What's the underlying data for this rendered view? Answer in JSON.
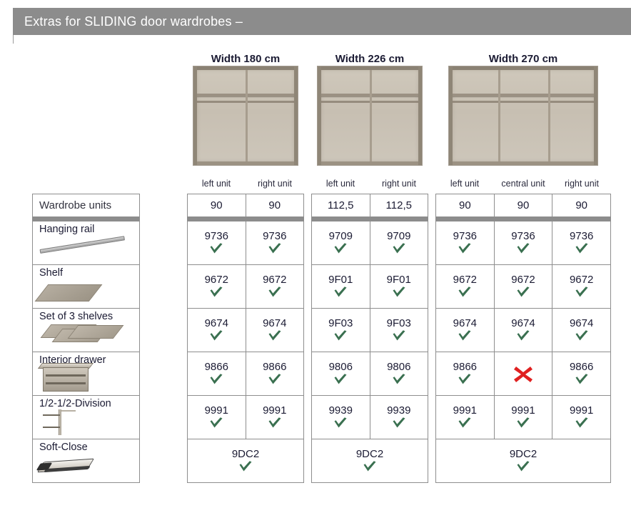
{
  "header": {
    "title": "Extras for SLIDING door wardrobes –"
  },
  "colors": {
    "header_bar": "#8c8c8c",
    "check_green": "#3a7050",
    "cross_red": "#e02020",
    "grid_line": "#8e8e8e",
    "text": "#1b1b33"
  },
  "sidebar": {
    "header_label": "Wardrobe units",
    "items": [
      {
        "label": "Hanging rail",
        "icon": "hanging-rail-icon"
      },
      {
        "label": "Shelf",
        "icon": "shelf-icon"
      },
      {
        "label": "Set of 3 shelves",
        "icon": "set-of-3-shelves-icon"
      },
      {
        "label": "Interior drawer",
        "icon": "interior-drawer-icon"
      },
      {
        "label": "1/2-1/2-Division",
        "icon": "half-half-division-icon"
      },
      {
        "label": "Soft-Close",
        "icon": "soft-close-icon"
      }
    ]
  },
  "groups": [
    {
      "id": "width-180",
      "heading": "Width 180 cm",
      "photo_alt": "wardrobe-180-interior",
      "photo_sections": 2,
      "unit_labels": [
        "left unit",
        "right unit"
      ],
      "unit_widths": [
        "90",
        "90"
      ],
      "rows": [
        {
          "item": "Hanging rail",
          "cells": [
            {
              "code": "9736",
              "mark": "check"
            },
            {
              "code": "9736",
              "mark": "check"
            }
          ]
        },
        {
          "item": "Shelf",
          "cells": [
            {
              "code": "9672",
              "mark": "check"
            },
            {
              "code": "9672",
              "mark": "check"
            }
          ]
        },
        {
          "item": "Set of 3 shelves",
          "cells": [
            {
              "code": "9674",
              "mark": "check"
            },
            {
              "code": "9674",
              "mark": "check"
            }
          ]
        },
        {
          "item": "Interior drawer",
          "cells": [
            {
              "code": "9866",
              "mark": "check"
            },
            {
              "code": "9866",
              "mark": "check"
            }
          ]
        },
        {
          "item": "1/2-1/2-Division",
          "cells": [
            {
              "code": "9991",
              "mark": "check"
            },
            {
              "code": "9991",
              "mark": "check"
            }
          ]
        }
      ],
      "footer_row": {
        "item": "Soft-Close",
        "code": "9DC2",
        "mark": "check"
      }
    },
    {
      "id": "width-226",
      "heading": "Width 226 cm",
      "photo_alt": "wardrobe-226-interior",
      "photo_sections": 2,
      "unit_labels": [
        "left unit",
        "right unit"
      ],
      "unit_widths": [
        "112,5",
        "112,5"
      ],
      "rows": [
        {
          "item": "Hanging rail",
          "cells": [
            {
              "code": "9709",
              "mark": "check"
            },
            {
              "code": "9709",
              "mark": "check"
            }
          ]
        },
        {
          "item": "Shelf",
          "cells": [
            {
              "code": "9F01",
              "mark": "check"
            },
            {
              "code": "9F01",
              "mark": "check"
            }
          ]
        },
        {
          "item": "Set of 3 shelves",
          "cells": [
            {
              "code": "9F03",
              "mark": "check"
            },
            {
              "code": "9F03",
              "mark": "check"
            }
          ]
        },
        {
          "item": "Interior drawer",
          "cells": [
            {
              "code": "9806",
              "mark": "check"
            },
            {
              "code": "9806",
              "mark": "check"
            }
          ]
        },
        {
          "item": "1/2-1/2-Division",
          "cells": [
            {
              "code": "9939",
              "mark": "check"
            },
            {
              "code": "9939",
              "mark": "check"
            }
          ]
        }
      ],
      "footer_row": {
        "item": "Soft-Close",
        "code": "9DC2",
        "mark": "check"
      }
    },
    {
      "id": "width-270",
      "heading": "Width 270 cm",
      "photo_alt": "wardrobe-270-interior",
      "photo_sections": 3,
      "unit_labels": [
        "left unit",
        "central unit",
        "right unit"
      ],
      "unit_widths": [
        "90",
        "90",
        "90"
      ],
      "rows": [
        {
          "item": "Hanging rail",
          "cells": [
            {
              "code": "9736",
              "mark": "check"
            },
            {
              "code": "9736",
              "mark": "check"
            },
            {
              "code": "9736",
              "mark": "check"
            }
          ]
        },
        {
          "item": "Shelf",
          "cells": [
            {
              "code": "9672",
              "mark": "check"
            },
            {
              "code": "9672",
              "mark": "check"
            },
            {
              "code": "9672",
              "mark": "check"
            }
          ]
        },
        {
          "item": "Set of 3 shelves",
          "cells": [
            {
              "code": "9674",
              "mark": "check"
            },
            {
              "code": "9674",
              "mark": "check"
            },
            {
              "code": "9674",
              "mark": "check"
            }
          ]
        },
        {
          "item": "Interior drawer",
          "cells": [
            {
              "code": "9866",
              "mark": "check"
            },
            {
              "code": "",
              "mark": "cross"
            },
            {
              "code": "9866",
              "mark": "check"
            }
          ]
        },
        {
          "item": "1/2-1/2-Division",
          "cells": [
            {
              "code": "9991",
              "mark": "check"
            },
            {
              "code": "9991",
              "mark": "check"
            },
            {
              "code": "9991",
              "mark": "check"
            }
          ]
        }
      ],
      "footer_row": {
        "item": "Soft-Close",
        "code": "9DC2",
        "mark": "check"
      }
    }
  ]
}
